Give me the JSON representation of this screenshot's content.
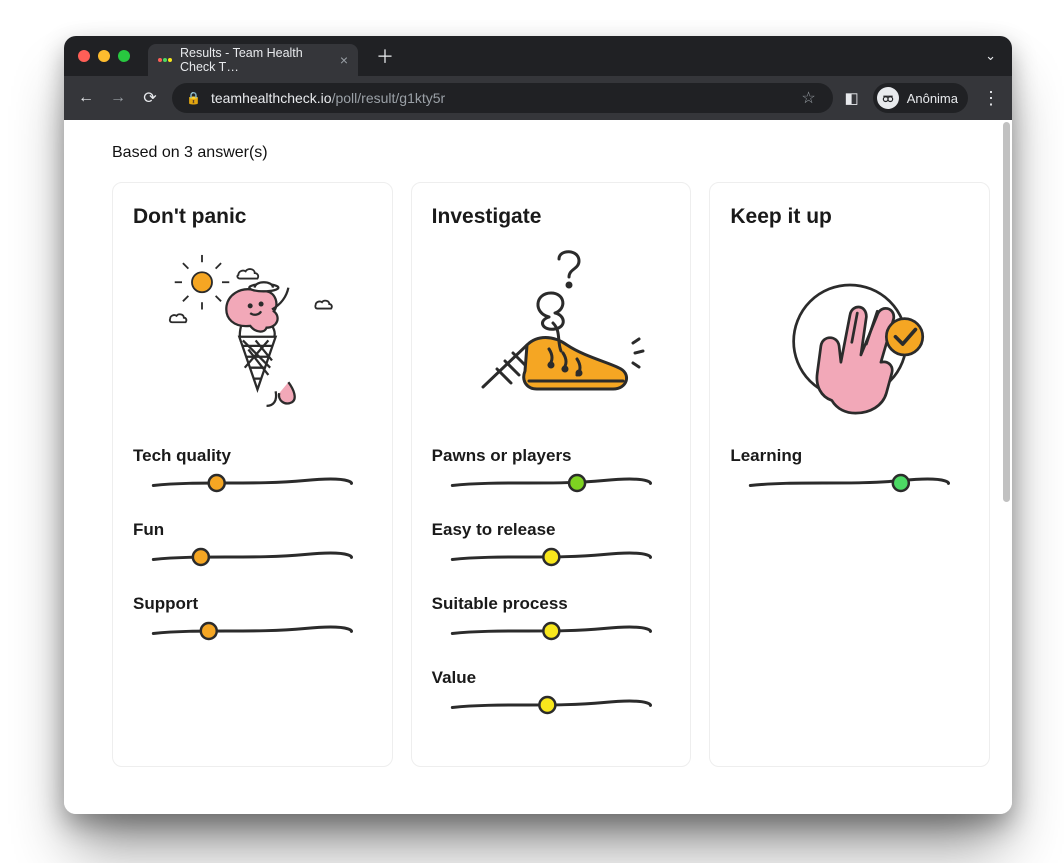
{
  "browser": {
    "tab_title": "Results - Team Health Check T…",
    "url_host": "teamhealthcheck.io",
    "url_path": "/poll/result/g1kty5r",
    "profile_label": "Anônima"
  },
  "page": {
    "based_on": "Based on 3 answer(s)",
    "columns": [
      {
        "title": "Don't panic",
        "illustration": "melting-ice-cream",
        "metrics": [
          {
            "label": "Tech quality",
            "pos": 0.32,
            "color": "orange"
          },
          {
            "label": "Fun",
            "pos": 0.24,
            "color": "orange"
          },
          {
            "label": "Support",
            "pos": 0.28,
            "color": "orange"
          }
        ]
      },
      {
        "title": "Investigate",
        "illustration": "tripping-shoe",
        "metrics": [
          {
            "label": "Pawns or players",
            "pos": 0.63,
            "color": "lime"
          },
          {
            "label": "Easy to release",
            "pos": 0.5,
            "color": "yellow"
          },
          {
            "label": "Suitable process",
            "pos": 0.5,
            "color": "yellow"
          },
          {
            "label": "Value",
            "pos": 0.48,
            "color": "yellow"
          }
        ]
      },
      {
        "title": "Keep it up",
        "illustration": "peace-hand",
        "metrics": [
          {
            "label": "Learning",
            "pos": 0.76,
            "color": "green"
          }
        ]
      }
    ]
  },
  "colors": {
    "orange": "#f5a623",
    "yellow": "#f8e71c",
    "lime": "#7ed321",
    "green": "#4cd964",
    "pink": "#f2a8b8",
    "ink": "#2b2b2b"
  }
}
